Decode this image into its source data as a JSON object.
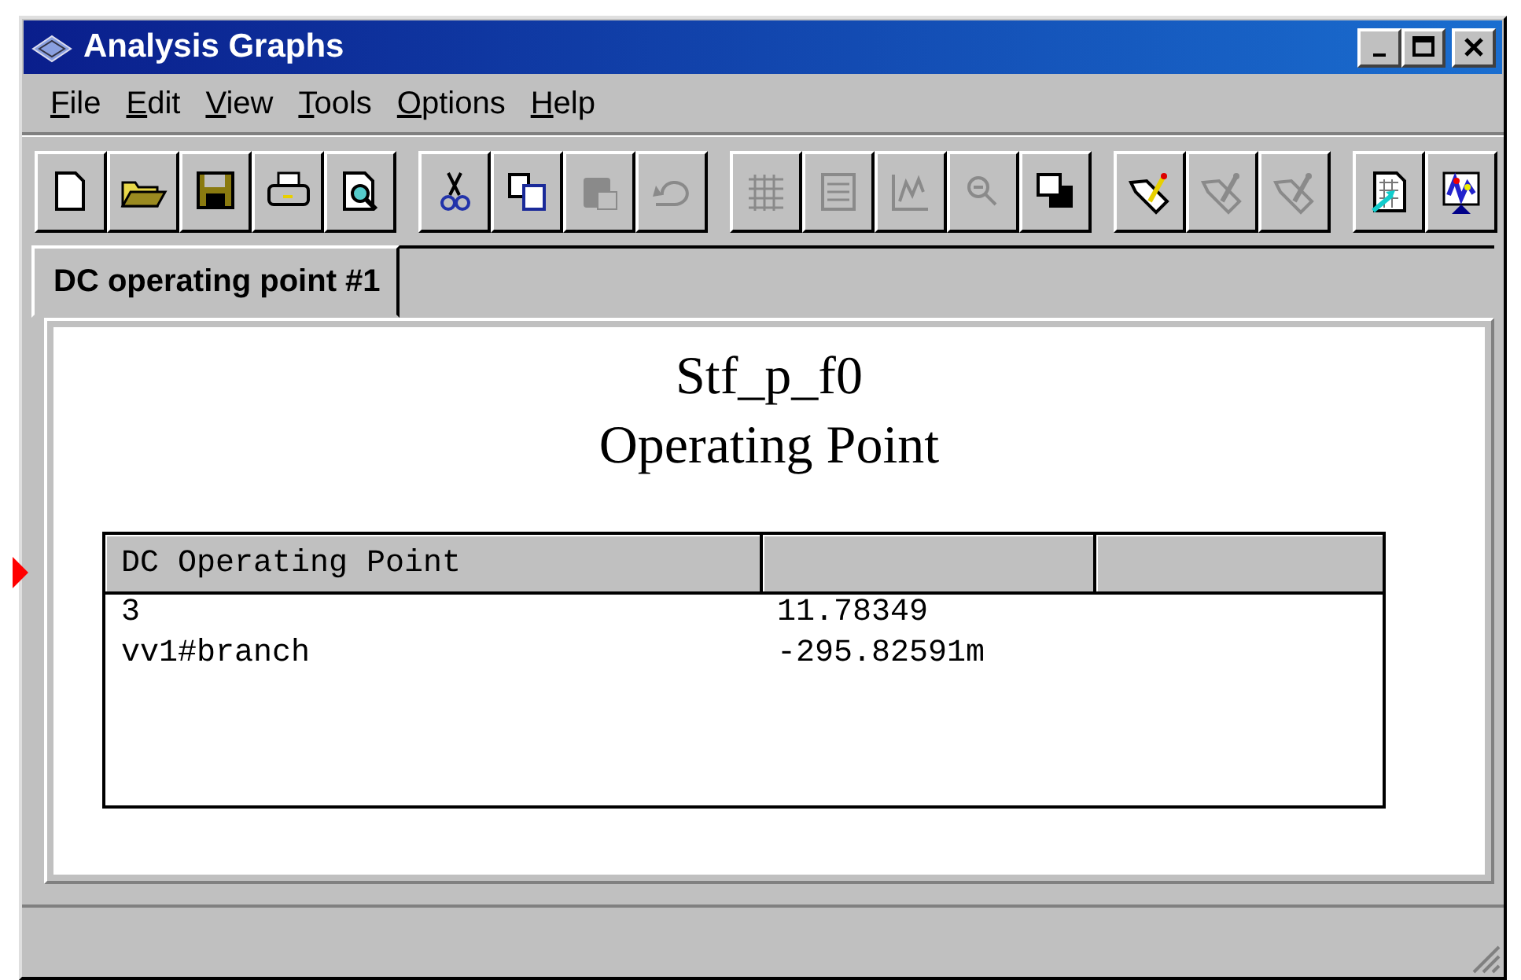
{
  "window": {
    "title": "Analysis Graphs"
  },
  "menu": [
    "File",
    "Edit",
    "View",
    "Tools",
    "Options",
    "Help"
  ],
  "toolbar": [
    [
      {
        "kind": "new",
        "disabled": false
      },
      {
        "kind": "open",
        "disabled": false
      },
      {
        "kind": "save",
        "disabled": false
      },
      {
        "kind": "print",
        "disabled": false
      },
      {
        "kind": "preview",
        "disabled": false
      }
    ],
    [
      {
        "kind": "cut",
        "disabled": false
      },
      {
        "kind": "copy",
        "disabled": false
      },
      {
        "kind": "paste",
        "disabled": true
      },
      {
        "kind": "undo",
        "disabled": true
      }
    ],
    [
      {
        "kind": "grid",
        "disabled": true
      },
      {
        "kind": "list",
        "disabled": true
      },
      {
        "kind": "chart",
        "disabled": true
      },
      {
        "kind": "zoom",
        "disabled": true
      },
      {
        "kind": "overlap",
        "disabled": false
      }
    ],
    [
      {
        "kind": "tag",
        "disabled": false
      },
      {
        "kind": "tag",
        "disabled": true
      },
      {
        "kind": "tag",
        "disabled": true
      }
    ],
    [
      {
        "kind": "export",
        "disabled": false
      },
      {
        "kind": "graph",
        "disabled": false
      }
    ]
  ],
  "tabs": [
    {
      "label": "DC operating point #1",
      "selected": true
    }
  ],
  "heading": [
    "Stf_p_f0",
    "Operating Point"
  ],
  "table": {
    "columns": [
      "DC Operating Point",
      "",
      ""
    ],
    "rows": [
      [
        "3",
        "11.78349",
        ""
      ],
      [
        "vv1#branch",
        "-295.82591m",
        ""
      ]
    ]
  }
}
